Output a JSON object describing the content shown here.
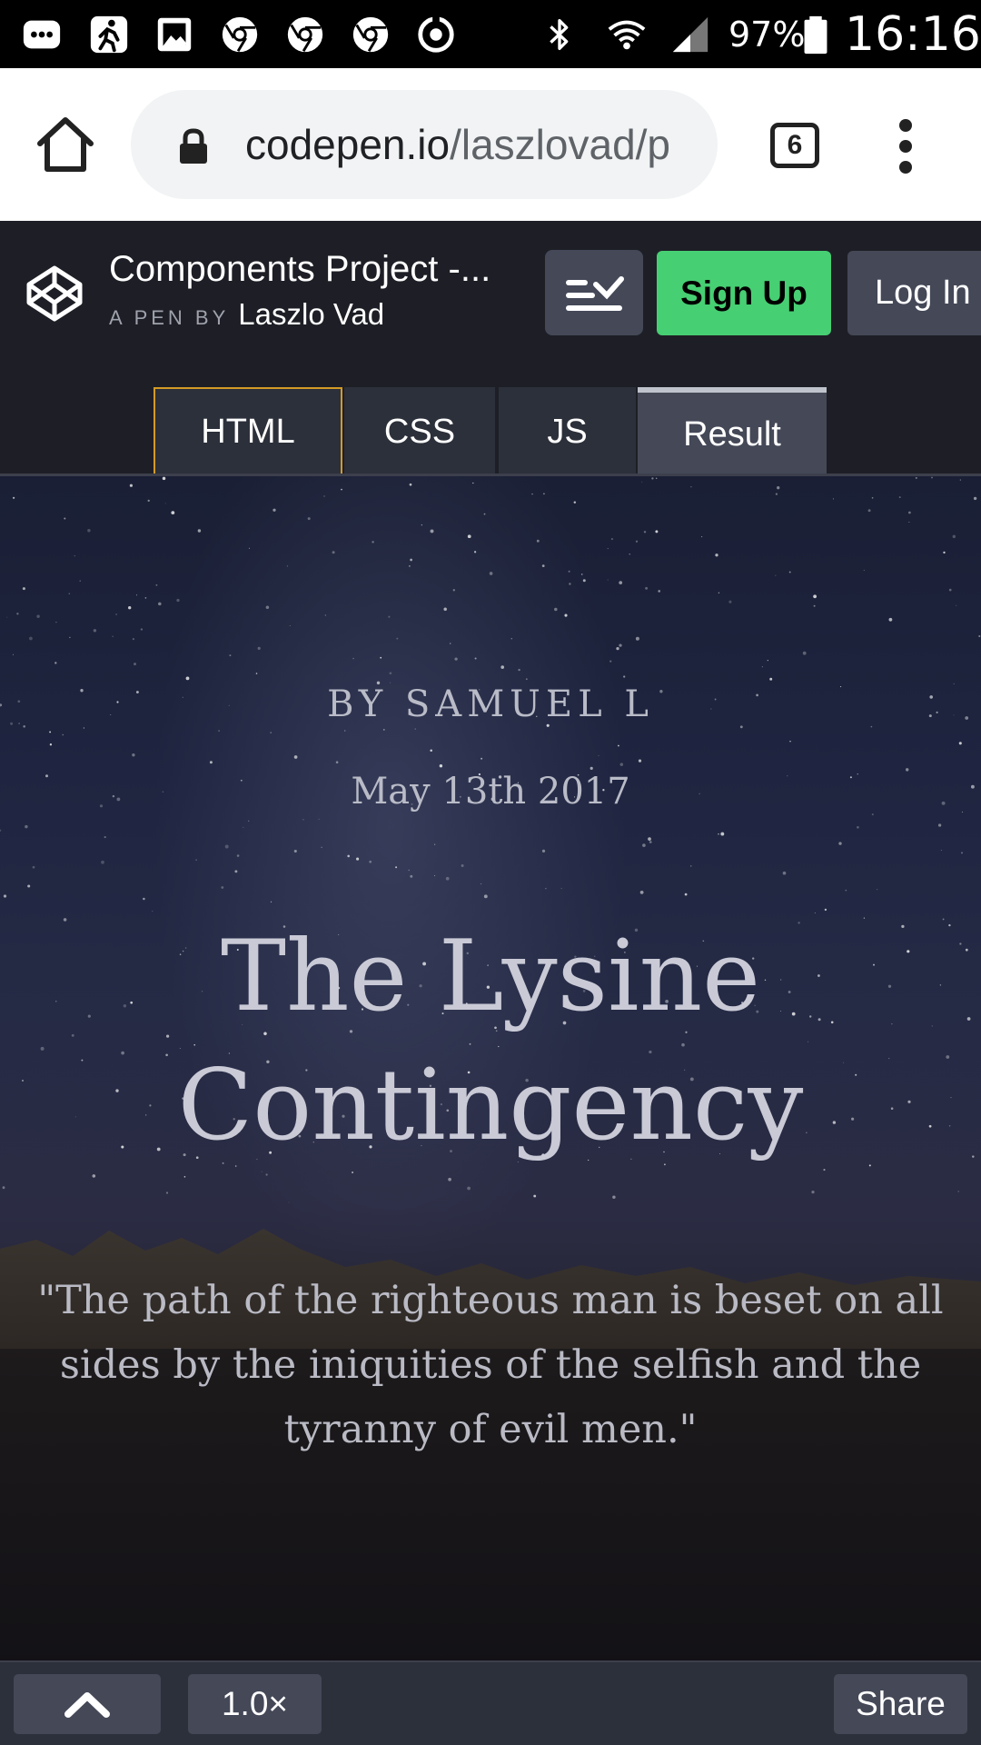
{
  "status_bar": {
    "battery": "97%",
    "time": "16:16",
    "icons": [
      "messages-icon",
      "activity-icon",
      "gallery-icon",
      "chrome-icon",
      "chrome-icon",
      "chrome-icon",
      "sync-icon",
      "bluetooth-icon",
      "wifi-icon",
      "signal-icon",
      "battery-icon"
    ]
  },
  "browser": {
    "url_host": "codepen.io",
    "url_path": "/laszlovad/p",
    "tab_count": "6",
    "icons": [
      "home-icon",
      "lock-icon",
      "tabs-icon",
      "overflow-menu-icon"
    ]
  },
  "codepen": {
    "title": "Components Project -...",
    "byline_label": "A PEN BY",
    "author": "Laszlo Vad",
    "signup_label": "Sign Up",
    "login_label": "Log In",
    "icons": [
      "codepen-logo-icon",
      "layout-settings-icon"
    ]
  },
  "tabs": [
    {
      "label": "HTML"
    },
    {
      "label": "CSS"
    },
    {
      "label": "JS"
    },
    {
      "label": "Result"
    }
  ],
  "result": {
    "author_line": "BY SAMUEL L",
    "date": "May 13th 2017",
    "title": "The Lysine Contingency",
    "quote": "\"The path of the righteous man is beset on all sides by the iniquities of the selfish and the tyranny of evil men.\""
  },
  "bottom_bar": {
    "zoom": "1.0×",
    "share_label": "Share",
    "icons": [
      "chevron-up-icon"
    ]
  },
  "colors": {
    "signup_green": "#47cf73",
    "codepen_dark": "#1e1f26",
    "tab_active_border": "#d49b25"
  }
}
